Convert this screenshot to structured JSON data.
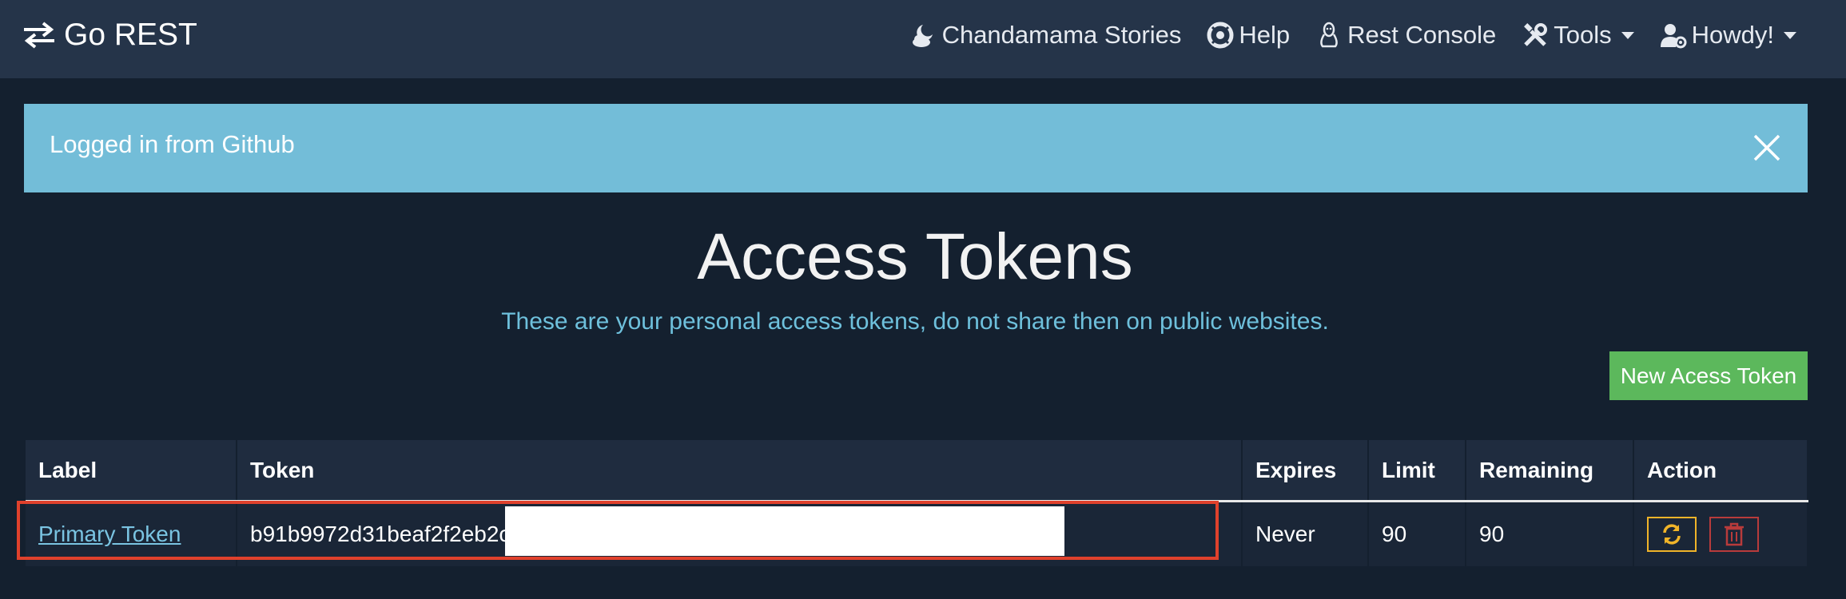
{
  "navbar": {
    "brand": "Go REST",
    "items": [
      {
        "label": "Chandamama Stories",
        "icon": "moon-cloud-icon"
      },
      {
        "label": "Help",
        "icon": "life-ring-icon"
      },
      {
        "label": "Rest Console",
        "icon": "linux-icon"
      },
      {
        "label": "Tools",
        "icon": "tools-icon",
        "dropdown": true
      },
      {
        "label": "Howdy!",
        "icon": "user-cog-icon",
        "dropdown": true
      }
    ]
  },
  "alert": {
    "message": "Logged in from Github",
    "color": "#73bdd8"
  },
  "page": {
    "title": "Access Tokens",
    "subtitle": "These are your personal access tokens, do not share then on public websites.",
    "new_token_label": "New Acess Token"
  },
  "table": {
    "headers": [
      "Label",
      "Token",
      "Expires",
      "Limit",
      "Remaining",
      "Action"
    ],
    "rows": [
      {
        "label": "Primary Token",
        "token": "b91b9972d31beaf2f2eb2c",
        "expires": "Never",
        "limit": "90",
        "remaining": "90"
      }
    ]
  },
  "colors": {
    "background": "#14202f",
    "navbar": "#253449",
    "success": "#5cb85c",
    "warning": "#f0b429",
    "danger": "#b83b3b",
    "highlight": "#e0412c"
  }
}
